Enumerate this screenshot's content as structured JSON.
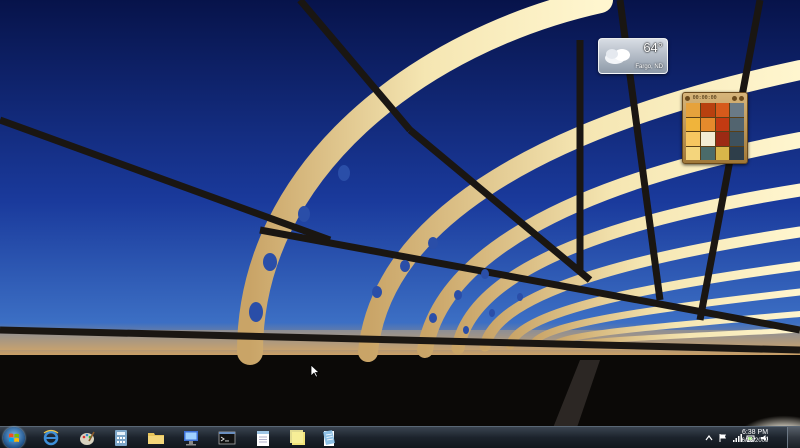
{
  "desktop": {
    "colors": {
      "sky_top": "#0a1a5c",
      "sky_mid": "#1d3fa0",
      "horizon": "#e9b468",
      "bridge_glow": "#f6e7b0",
      "taskbar": "#1c232c"
    }
  },
  "weather_gadget": {
    "temperature": "64°",
    "location": "Fargo, ND",
    "icon": "cloudy-icon"
  },
  "puzzle_gadget": {
    "timer": "00:00:00",
    "tiles": [
      "#e6a23c",
      "#b8400f",
      "#d65a1b",
      "#6a7a86",
      "#f0b43b",
      "#e58a2c",
      "#c33a12",
      "#52646f",
      "#f7c660",
      "#f3ecd3",
      "#9c2a14",
      "#3e515d",
      "#f4d57c",
      "#4a6b6a",
      "#d8b64a",
      "#2e3e4a"
    ]
  },
  "taskbar": {
    "start_icon": "windows-flag-icon",
    "pinned": [
      {
        "name": "internet-explorer-icon",
        "color": "#3f8fd8"
      },
      {
        "name": "paint-icon",
        "color": "#d9d3c0"
      },
      {
        "name": "media-player-icon",
        "color": "#d84a7a"
      },
      {
        "name": "calculator-icon",
        "color": "#7da6c8"
      },
      {
        "name": "explorer-folder-icon",
        "color": "#e7c45a"
      },
      {
        "name": "remote-desktop-icon",
        "color": "#3c6fd6"
      },
      {
        "name": "command-prompt-icon",
        "color": "#111111"
      },
      {
        "name": "notepad-icon",
        "color": "#9ec6e6"
      },
      {
        "name": "sticky-notes-icon",
        "color": "#f1e37a"
      },
      {
        "name": "wordpad-icon",
        "color": "#7bb6e0"
      }
    ],
    "tray_icons": [
      "show-hidden-icons-icon",
      "action-center-flag-icon",
      "network-icon",
      "power-icon",
      "volume-icon"
    ],
    "clock_time": "6:38 PM",
    "clock_date": "6/18/2009"
  }
}
